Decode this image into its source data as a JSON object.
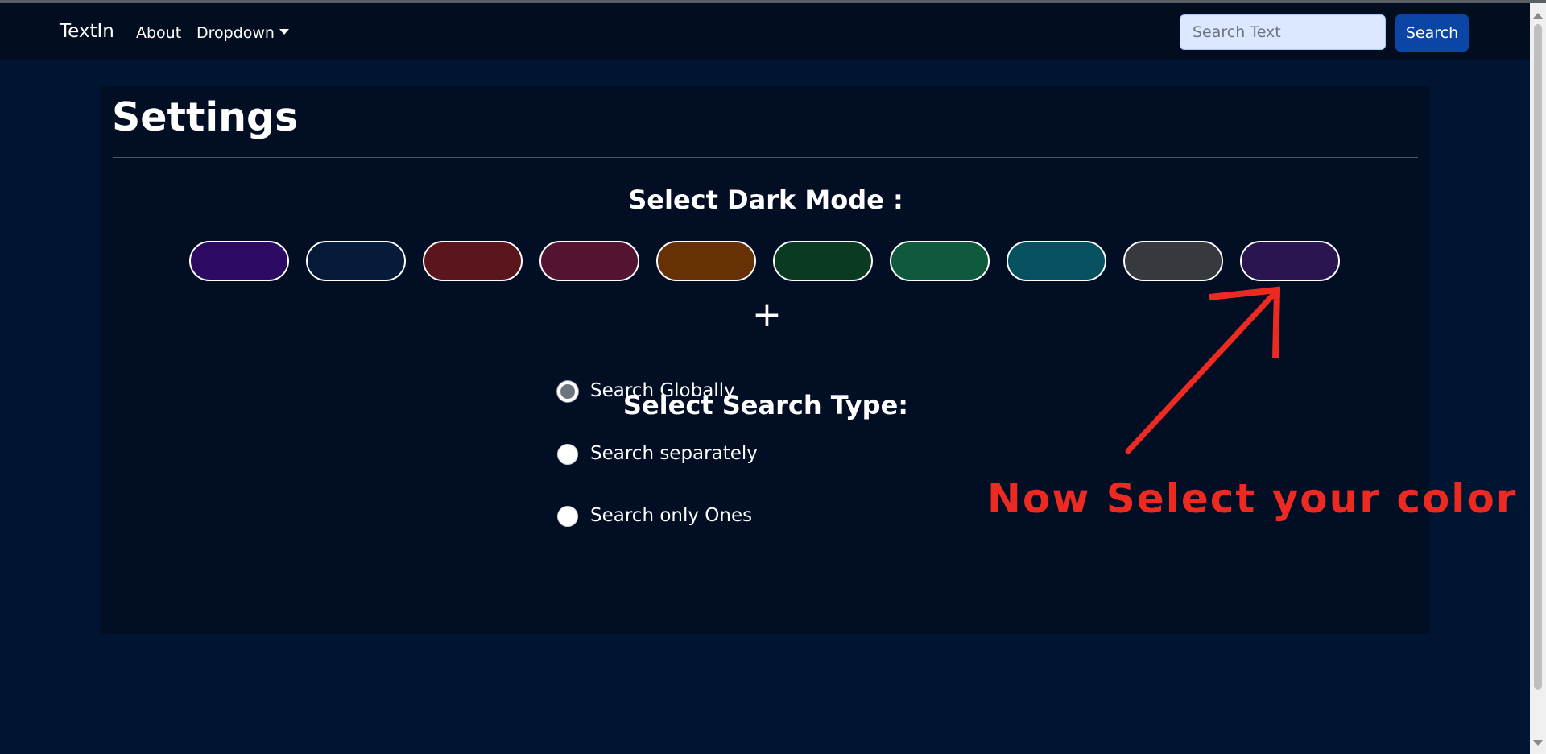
{
  "navbar": {
    "brand": "TextIn",
    "links": [
      "About",
      "Dropdown"
    ],
    "search_placeholder": "Search Text",
    "search_button": "Search"
  },
  "settings": {
    "title": "Settings",
    "dark_mode_title": "Select Dark Mode :",
    "add_icon": "plus-icon",
    "color_options": [
      "#2c0a63",
      "#061a3a",
      "#5a151d",
      "#541431",
      "#673106",
      "#0b3a22",
      "#0f5a3c",
      "#05515f",
      "#36393d",
      "#2a1551"
    ],
    "search_type_title": "Select Search Type:",
    "search_types": [
      {
        "label": "Search Globally",
        "checked": true
      },
      {
        "label": "Search separately",
        "checked": false
      },
      {
        "label": "Search only Ones",
        "checked": false
      }
    ]
  },
  "annotation": {
    "text": "Now Select your color",
    "color": "#ec2a21"
  },
  "colors": {
    "page_background": "#001531",
    "panel_background": "#010e24",
    "navbar_background": "#020d1f",
    "search_button": "#0b45a6"
  }
}
